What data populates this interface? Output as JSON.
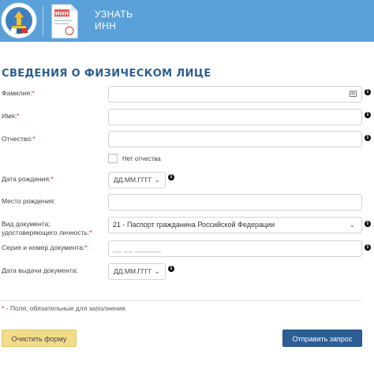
{
  "header": {
    "service_line1": "УЗНАТЬ",
    "service_line2": "ИНН",
    "doc_icon_text": "ИНН",
    "background_color": "#5aa1d9"
  },
  "form": {
    "heading": "СВЕДЕНИЯ О ФИЗИЧЕСКОМ ЛИЦЕ",
    "required_mark": "*",
    "fields": {
      "surname": {
        "label": "Фамилия:",
        "value": ""
      },
      "name": {
        "label": "Имя:",
        "value": ""
      },
      "patronymic": {
        "label": "Отчество:",
        "value": ""
      },
      "no_patronymic": {
        "label": "Нет отчества",
        "checked": false
      },
      "birth_date": {
        "label": "Дата рождения:",
        "placeholder": "ДД.ММ.ГГГГ"
      },
      "birth_place": {
        "label": "Место рождения:",
        "value": ""
      },
      "doc_type": {
        "label_line1": "Вид документа;",
        "label_line2": "удостоверяющего личность:",
        "selected": "21 - Паспорт гражданина Российской Федерации"
      },
      "doc_number": {
        "label": "Серия и номер документа:",
        "mask": "__ __ ______"
      },
      "issue_date": {
        "label": "Дата выдачи документа:",
        "placeholder": "ДД.ММ.ГГГГ"
      }
    },
    "note_mark": "* -",
    "note_text": " Поля, обязательные для заполнения",
    "buttons": {
      "clear": "Очистить форму",
      "submit": "Отправить запрос"
    }
  },
  "colors": {
    "heading": "#2b5e8f",
    "required": "#e0202a",
    "clear_button": "#f1dc8a",
    "submit_button": "#2d5f96"
  }
}
